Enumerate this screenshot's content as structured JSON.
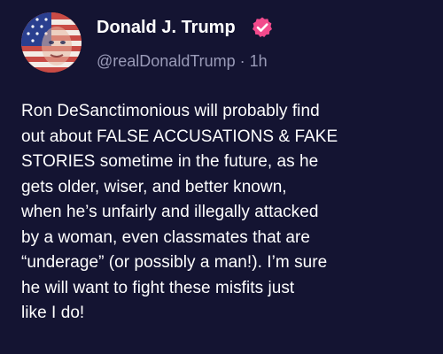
{
  "post": {
    "author": {
      "display_name": "Donald J. Trump",
      "verified": true,
      "handle": "@realDonaldTrump",
      "time_ago": "1h",
      "separator": "·",
      "avatar_icon": "flag-face-avatar",
      "verified_icon": "verified-badge-icon"
    },
    "text": "Ron DeSanctimonious will probably find\nout about FALSE ACCUSATIONS & FAKE\nSTORIES sometime in the future, as he\ngets older, wiser, and better known,\nwhen he’s unfairly and illegally attacked\nby a woman, even classmates that are\n“underage” (or possibly a man!). I’m sure\nhe will want to fight these misfits just\nlike I do!"
  },
  "colors": {
    "background": "#141432",
    "text": "#ffffff",
    "muted_text": "#9a9bb8",
    "verified_badge": "#f24a8c"
  }
}
